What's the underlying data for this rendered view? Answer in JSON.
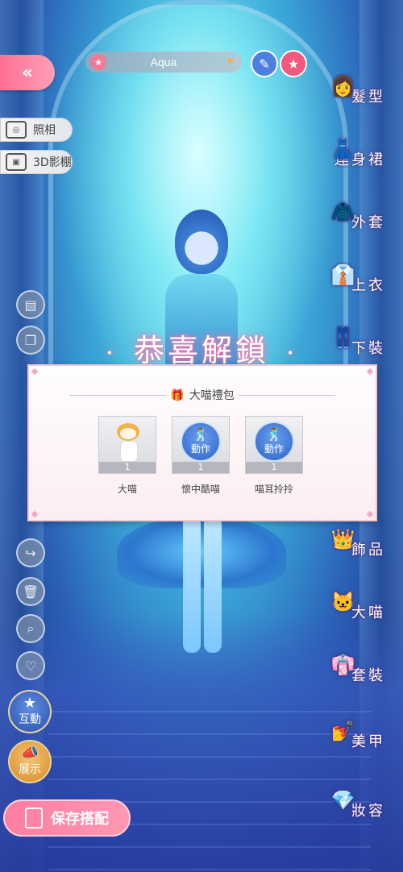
{
  "header": {
    "outfit_name": "Aqua",
    "back_glyph": "«",
    "pencil_glyph": "✎",
    "star_glyph": "★"
  },
  "left_panel": {
    "photo_label": "照相",
    "studio_label": "3D影棚",
    "interact_label": "互動",
    "display_label": "展示",
    "save_label": "保存搭配"
  },
  "categories": [
    {
      "label": "髮型",
      "icon": "hair-icon",
      "glyph": "👩"
    },
    {
      "label": "連身裙",
      "icon": "dress-icon",
      "glyph": "👗"
    },
    {
      "label": "外套",
      "icon": "coat-icon",
      "glyph": "🧥"
    },
    {
      "label": "上衣",
      "icon": "shirt-icon",
      "glyph": "👔"
    },
    {
      "label": "下裝",
      "icon": "skirt-icon",
      "glyph": "👖"
    },
    {
      "label": "飾品",
      "icon": "tiara-icon",
      "glyph": "👑"
    },
    {
      "label": "大喵",
      "icon": "cat-icon",
      "glyph": "🐱"
    },
    {
      "label": "套裝",
      "icon": "outfit-icon",
      "glyph": "👘"
    },
    {
      "label": "美甲",
      "icon": "nail-polish-icon",
      "glyph": "💅"
    },
    {
      "label": "妝容",
      "icon": "makeup-icon",
      "glyph": "💎"
    }
  ],
  "unlock": {
    "title": "恭喜解鎖",
    "pack_name": "大喵禮包",
    "items": [
      {
        "label": "大喵",
        "count": "1",
        "badge": ""
      },
      {
        "label": "懷中酷喵",
        "count": "1",
        "badge": "動作"
      },
      {
        "label": "喵耳拎拎",
        "count": "1",
        "badge": "動作"
      }
    ]
  },
  "colors": {
    "accent_pink": "#ff7ea0",
    "accent_blue": "#4d7fe3",
    "panel_bg": "#fffdfd"
  }
}
